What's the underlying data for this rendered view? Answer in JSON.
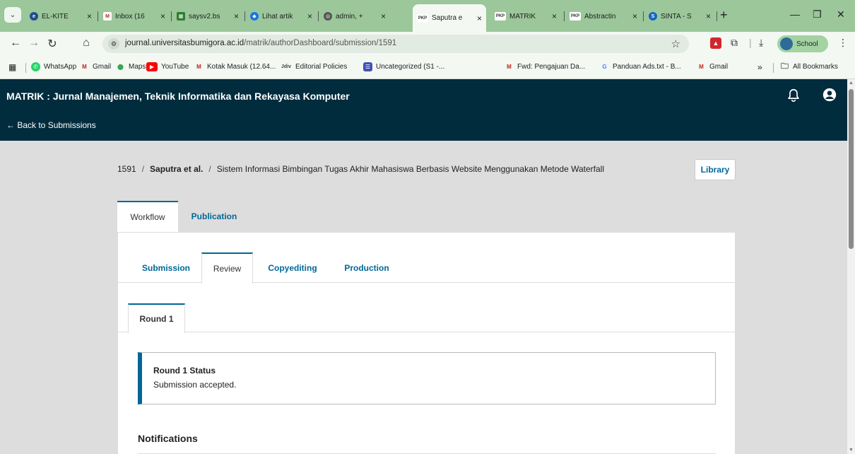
{
  "browser": {
    "tabs": [
      {
        "label": "EL-KITE",
        "icon": "el-kite-favicon",
        "color": "#1f4e8c"
      },
      {
        "label": "Inbox (16",
        "icon": "gmail-icon",
        "color": "#c5221f"
      },
      {
        "label": "saysv2.bs",
        "icon": "grid-favicon",
        "color": "#2e7d32"
      },
      {
        "label": "Lihat artik",
        "icon": "diamond-favicon",
        "color": "#1a73e8"
      },
      {
        "label": "admin, +",
        "icon": "globe-favicon",
        "color": "#555555"
      },
      {
        "label": "Saputra e",
        "icon": "pkp-favicon",
        "color": "#333333"
      },
      {
        "label": "MATRIK",
        "icon": "pkp-favicon",
        "color": "#333333"
      },
      {
        "label": "Abstractin",
        "icon": "pkp-favicon",
        "color": "#333333"
      },
      {
        "label": "SINTA - S",
        "icon": "sinta-favicon",
        "color": "#1565c0"
      }
    ],
    "tab_favicon_text": {
      "pkp": "PKP"
    },
    "url_domain": "journal.universitasbumigora.ac.id",
    "url_path": "/matrik/authorDashboard/submission/1591",
    "profile_label": "School",
    "bookmarks": [
      {
        "label": "WhatsApp",
        "color": "#25d366"
      },
      {
        "label": "Gmail",
        "color": "#c5221f"
      },
      {
        "label": "Maps",
        "color": "#34a853"
      },
      {
        "label": "YouTube",
        "color": "#ff0000"
      },
      {
        "label": "Kotak Masuk (12.64...",
        "color": "#c5221f"
      },
      {
        "label": "Editorial Policies",
        "color": "#444444"
      },
      {
        "label": "Uncategorized (S1 -...",
        "color": "#3f51b5"
      },
      {
        "label": "Fwd: Pengajuan Da...",
        "color": "#c5221f"
      },
      {
        "label": "Panduan Ads.txt - B...",
        "color": "#4285f4"
      },
      {
        "label": "Gmail",
        "color": "#c5221f"
      }
    ],
    "bookmark_overflow": "»",
    "all_bookmarks": "All Bookmarks"
  },
  "app": {
    "journal_title": "MATRIK : Jurnal Manajemen, Teknik Informatika dan Rekayasa Komputer",
    "back_link": "← Back to Submissions"
  },
  "breadcrumb": {
    "id": "1591",
    "author": "Saputra et al.",
    "title": "Sistem Informasi Bimbingan Tugas Akhir Mahasiswa Berbasis Website Menggunakan Metode Waterfall",
    "separator": "/"
  },
  "library_button": "Library",
  "main_tabs": [
    "Workflow",
    "Publication"
  ],
  "sub_tabs": [
    "Submission",
    "Review",
    "Copyediting",
    "Production"
  ],
  "round_tab": "Round 1",
  "status": {
    "title": "Round 1 Status",
    "text": "Submission accepted."
  },
  "notifications_heading": "Notifications",
  "colors": {
    "header_bg": "#002c3d",
    "accent": "#006798",
    "chrome_bar": "#9bc79a"
  }
}
